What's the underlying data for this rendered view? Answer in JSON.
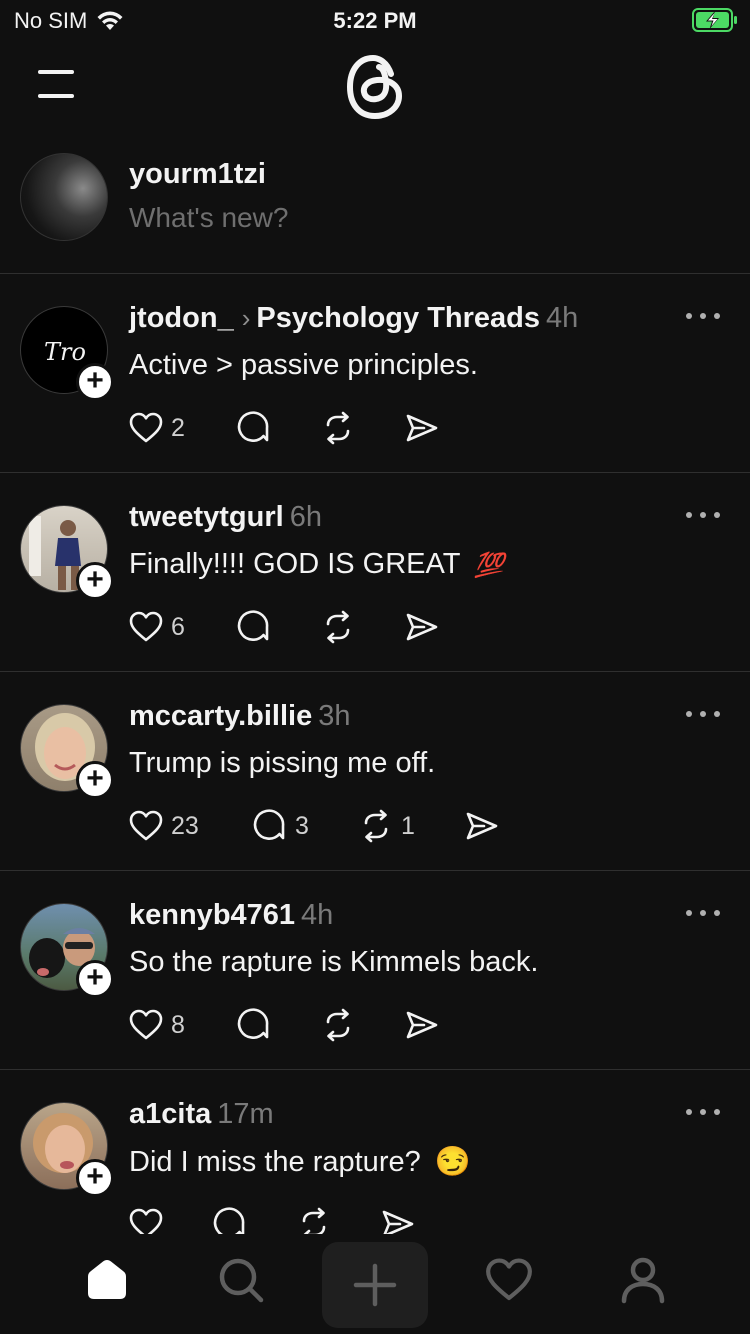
{
  "status_bar": {
    "carrier": "No SIM",
    "time": "5:22 PM"
  },
  "composer": {
    "username": "yourm1tzi",
    "placeholder": "What's new?"
  },
  "posts": [
    {
      "username": "jtodon_",
      "community": "Psychology Threads",
      "time": "4h",
      "text": "Active > passive principles.",
      "likes": "2",
      "replies": "",
      "reposts": "",
      "avatar_text": "Tro"
    },
    {
      "username": "tweetytgurl",
      "time": "6h",
      "text": "Finally!!!! GOD IS GREAT",
      "emoji": "💯",
      "likes": "6",
      "replies": "",
      "reposts": ""
    },
    {
      "username": "mccarty.billie",
      "time": "3h",
      "text": "Trump is pissing me off.",
      "likes": "23",
      "replies": "3",
      "reposts": "1"
    },
    {
      "username": "kennyb4761",
      "time": "4h",
      "text": "So the rapture is Kimmels back.",
      "likes": "8",
      "replies": "",
      "reposts": ""
    },
    {
      "username": "a1cita",
      "time": "17m",
      "text": "Did I miss the rapture?",
      "emoji": "😏",
      "likes": "",
      "replies": "",
      "reposts": ""
    }
  ],
  "icons": {
    "menu": "hamburger-icon",
    "logo": "threads-logo-icon",
    "like": "heart-icon",
    "reply": "comment-bubble-icon",
    "repost": "repost-icon",
    "share": "send-icon",
    "more": "more-dots-icon",
    "nav": [
      "home-icon",
      "search-icon",
      "plus-icon",
      "heart-icon",
      "profile-icon"
    ]
  },
  "colors": {
    "background": "#101010",
    "text": "#f3f3f3",
    "muted": "#7a7a7a",
    "battery": "#4cd964"
  }
}
